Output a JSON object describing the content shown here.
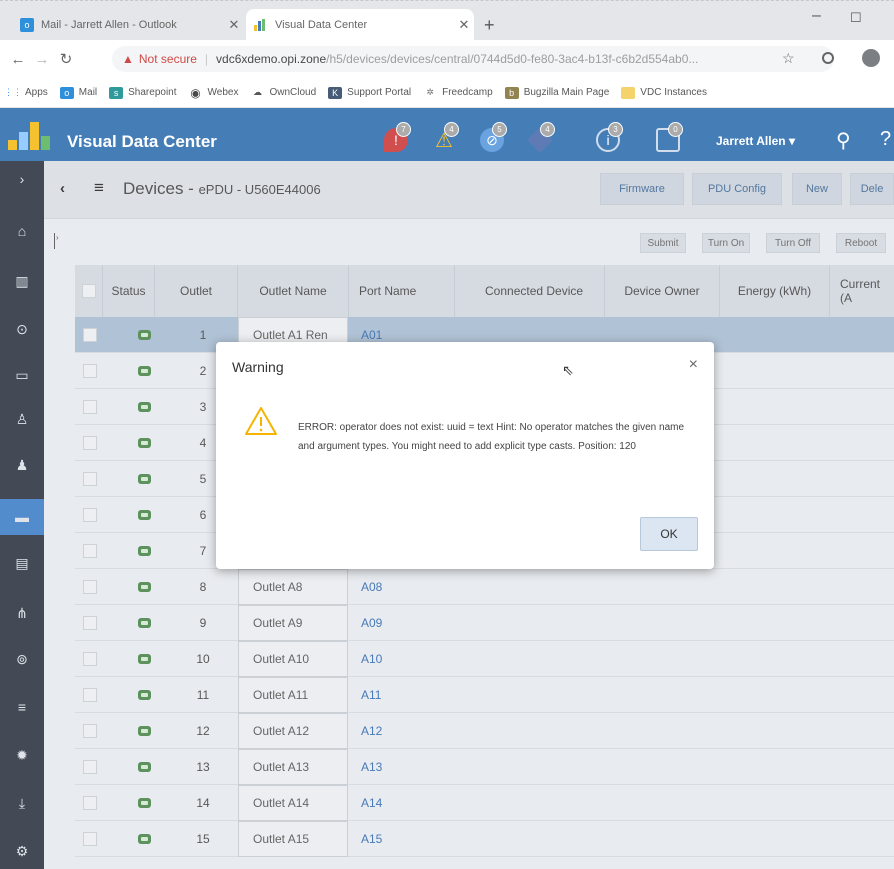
{
  "browser": {
    "tabs": [
      {
        "title": "Mail - Jarrett Allen - Outlook",
        "icon": "outlook-icon"
      },
      {
        "title": "Visual Data Center",
        "icon": "vdc-icon"
      }
    ],
    "new_tab": "+",
    "window_min": "–",
    "window_max": "☐",
    "security_label": "Not secure",
    "url_host": "vdc6xdemo.opi.zone",
    "url_path": "/h5/devices/devices/central/0744d5d0-fe80-3ac4-b13f-c6b2d554ab0..."
  },
  "bookmarks": [
    {
      "label": "Apps",
      "icon": "apps-grid-icon",
      "color": "#1a73e8"
    },
    {
      "label": "Mail",
      "icon": "outlook-icon",
      "color": "#0078d4"
    },
    {
      "label": "Sharepoint",
      "icon": "sharepoint-icon",
      "color": "#038387"
    },
    {
      "label": "Webex",
      "icon": "webex-icon",
      "color": "#222222"
    },
    {
      "label": "OwnCloud",
      "icon": "owncloud-icon",
      "color": "#333333"
    },
    {
      "label": "Support Portal",
      "icon": "support-portal-icon",
      "color": "#1f3a5a"
    },
    {
      "label": "Freedcamp",
      "icon": "freedcamp-icon",
      "color": "#555555"
    },
    {
      "label": "Bugzilla Main Page",
      "icon": "bugzilla-icon",
      "color": "#7a6a2a"
    },
    {
      "label": "VDC Instances",
      "icon": "folder-icon",
      "color": "#f2c94c"
    }
  ],
  "app": {
    "name": "Visual Data Center",
    "accent": "#1d62a8",
    "alerts": [
      {
        "count": "7",
        "icon": "critical-alert-icon",
        "color": "#c62828"
      },
      {
        "count": "4",
        "icon": "warning-alert-icon",
        "color": "#f5b400"
      },
      {
        "count": "5",
        "icon": "minor-alert-icon",
        "color": "#4a90d9"
      },
      {
        "count": "4",
        "icon": "info-alert-icon",
        "color": "#3b5fa5"
      },
      {
        "count": "3",
        "icon": "notice-alert-icon",
        "color": "#5a6f8a"
      },
      {
        "count": "0",
        "icon": "messages-icon",
        "color": "#5a6f8a"
      }
    ],
    "user": "Jarrett Allen"
  },
  "page": {
    "title_main": "Devices - ",
    "title_sub": "ePDU - U560E44006",
    "toolbar": [
      "Firmware",
      "PDU Config",
      "New",
      "Dele"
    ],
    "actions": [
      "Submit",
      "Turn On",
      "Turn Off",
      "Reboot"
    ]
  },
  "table": {
    "columns": [
      "Status",
      "Outlet",
      "Outlet Name",
      "Port Name",
      "Connected Device",
      "Device Owner",
      "Energy (kWh)",
      "Current (A"
    ],
    "rows": [
      {
        "outlet": "1",
        "name": "Outlet A1 Ren",
        "port": "A01"
      },
      {
        "outlet": "2",
        "name": "",
        "port": ""
      },
      {
        "outlet": "3",
        "name": "",
        "port": ""
      },
      {
        "outlet": "4",
        "name": "",
        "port": ""
      },
      {
        "outlet": "5",
        "name": "",
        "port": ""
      },
      {
        "outlet": "6",
        "name": "",
        "port": ""
      },
      {
        "outlet": "7",
        "name": "",
        "port": ""
      },
      {
        "outlet": "8",
        "name": "Outlet A8",
        "port": "A08"
      },
      {
        "outlet": "9",
        "name": "Outlet A9",
        "port": "A09"
      },
      {
        "outlet": "10",
        "name": "Outlet A10",
        "port": "A10"
      },
      {
        "outlet": "11",
        "name": "Outlet A11",
        "port": "A11"
      },
      {
        "outlet": "12",
        "name": "Outlet A12",
        "port": "A12"
      },
      {
        "outlet": "13",
        "name": "Outlet A13",
        "port": "A13"
      },
      {
        "outlet": "14",
        "name": "Outlet A14",
        "port": "A14"
      },
      {
        "outlet": "15",
        "name": "Outlet A15",
        "port": "A15"
      }
    ]
  },
  "dialog": {
    "title": "Warning",
    "close": "×",
    "message": "ERROR: operator does not exist: uuid = text Hint: No operator matches the given name and argument types. You might need to add explicit type casts. Position: 120",
    "ok": "OK"
  }
}
